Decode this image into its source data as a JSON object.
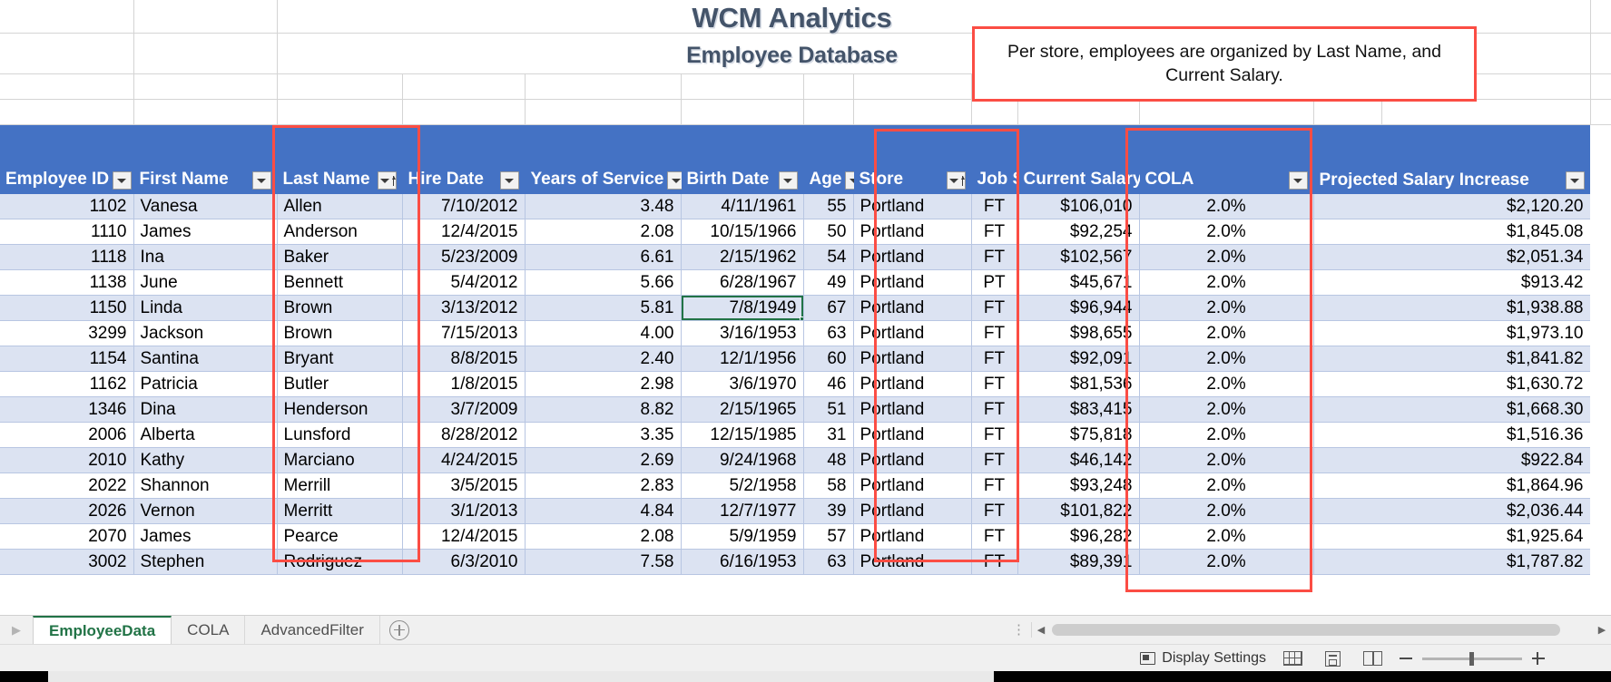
{
  "workbook": {
    "title": "WCM Analytics",
    "subtitle": "Employee Database"
  },
  "callout": {
    "text": "Per store, employees are organized by Last Name, and Current Salary.",
    "border_color": "#fb4d44"
  },
  "table": {
    "header_fill": "#4472c4",
    "band_fill": "#dce3f2",
    "columns": [
      {
        "label": "Employee ID",
        "align": "right",
        "filter": "plain"
      },
      {
        "label": "First Name",
        "align": "left",
        "filter": "plain"
      },
      {
        "label": "Last Name",
        "align": "left",
        "filter": "sorted"
      },
      {
        "label": "Hire Date",
        "align": "right",
        "filter": "plain"
      },
      {
        "label": "Years of Service",
        "align": "right",
        "filter": "plain"
      },
      {
        "label": "Birth Date",
        "align": "right",
        "filter": "plain"
      },
      {
        "label": "Age",
        "align": "right",
        "filter": "plain"
      },
      {
        "label": "Store",
        "align": "left",
        "filter": "sorted"
      },
      {
        "label": "Job Status",
        "align": "center",
        "filter": "plain"
      },
      {
        "label": "Current Salary",
        "align": "right",
        "filter": "sorted"
      },
      {
        "label": "COLA",
        "align": "center",
        "filter": "plain"
      },
      {
        "label": "Projected Salary Increase",
        "align": "right",
        "filter": "plain"
      }
    ],
    "rows": [
      [
        "1102",
        "Vanesa",
        "Allen",
        "7/10/2012",
        "3.48",
        "4/11/1961",
        "55",
        "Portland",
        "FT",
        "$106,010",
        "2.0%",
        "$2,120.20"
      ],
      [
        "1110",
        "James",
        "Anderson",
        "12/4/2015",
        "2.08",
        "10/15/1966",
        "50",
        "Portland",
        "FT",
        "$92,254",
        "2.0%",
        "$1,845.08"
      ],
      [
        "1118",
        "Ina",
        "Baker",
        "5/23/2009",
        "6.61",
        "2/15/1962",
        "54",
        "Portland",
        "FT",
        "$102,567",
        "2.0%",
        "$2,051.34"
      ],
      [
        "1138",
        "June",
        "Bennett",
        "5/4/2012",
        "5.66",
        "6/28/1967",
        "49",
        "Portland",
        "PT",
        "$45,671",
        "2.0%",
        "$913.42"
      ],
      [
        "1150",
        "Linda",
        "Brown",
        "3/13/2012",
        "5.81",
        "7/8/1949",
        "67",
        "Portland",
        "FT",
        "$96,944",
        "2.0%",
        "$1,938.88"
      ],
      [
        "3299",
        "Jackson",
        "Brown",
        "7/15/2013",
        "4.00",
        "3/16/1953",
        "63",
        "Portland",
        "FT",
        "$98,655",
        "2.0%",
        "$1,973.10"
      ],
      [
        "1154",
        "Santina",
        "Bryant",
        "8/8/2015",
        "2.40",
        "12/1/1956",
        "60",
        "Portland",
        "FT",
        "$92,091",
        "2.0%",
        "$1,841.82"
      ],
      [
        "1162",
        "Patricia",
        "Butler",
        "1/8/2015",
        "2.98",
        "3/6/1970",
        "46",
        "Portland",
        "FT",
        "$81,536",
        "2.0%",
        "$1,630.72"
      ],
      [
        "1346",
        "Dina",
        "Henderson",
        "3/7/2009",
        "8.82",
        "2/15/1965",
        "51",
        "Portland",
        "FT",
        "$83,415",
        "2.0%",
        "$1,668.30"
      ],
      [
        "2006",
        "Alberta",
        "Lunsford",
        "8/28/2012",
        "3.35",
        "12/15/1985",
        "31",
        "Portland",
        "FT",
        "$75,818",
        "2.0%",
        "$1,516.36"
      ],
      [
        "2010",
        "Kathy",
        "Marciano",
        "4/24/2015",
        "2.69",
        "9/24/1968",
        "48",
        "Portland",
        "FT",
        "$46,142",
        "2.0%",
        "$922.84"
      ],
      [
        "2022",
        "Shannon",
        "Merrill",
        "3/5/2015",
        "2.83",
        "5/2/1958",
        "58",
        "Portland",
        "FT",
        "$93,248",
        "2.0%",
        "$1,864.96"
      ],
      [
        "2026",
        "Vernon",
        "Merritt",
        "3/1/2013",
        "4.84",
        "12/7/1977",
        "39",
        "Portland",
        "FT",
        "$101,822",
        "2.0%",
        "$2,036.44"
      ],
      [
        "2070",
        "James",
        "Pearce",
        "12/4/2015",
        "2.08",
        "5/9/1959",
        "57",
        "Portland",
        "FT",
        "$96,282",
        "2.0%",
        "$1,925.64"
      ],
      [
        "3002",
        "Stephen",
        "Rodriguez",
        "6/3/2010",
        "7.58",
        "6/16/1953",
        "63",
        "Portland",
        "FT",
        "$89,391",
        "2.0%",
        "$1,787.82"
      ]
    ],
    "selected_cell": {
      "row": 4,
      "col": 5,
      "value": "7/8/1949",
      "outline_color": "#217346"
    }
  },
  "sheet_tabs": {
    "tabs": [
      {
        "name": "EmployeeData",
        "active": true
      },
      {
        "name": "COLA",
        "active": false
      },
      {
        "name": "AdvancedFilter",
        "active": false
      }
    ],
    "add_label": "+"
  },
  "status_bar": {
    "display_settings": "Display Settings",
    "zoom_minus": "−",
    "zoom_plus": "+",
    "zoom_level": ""
  }
}
